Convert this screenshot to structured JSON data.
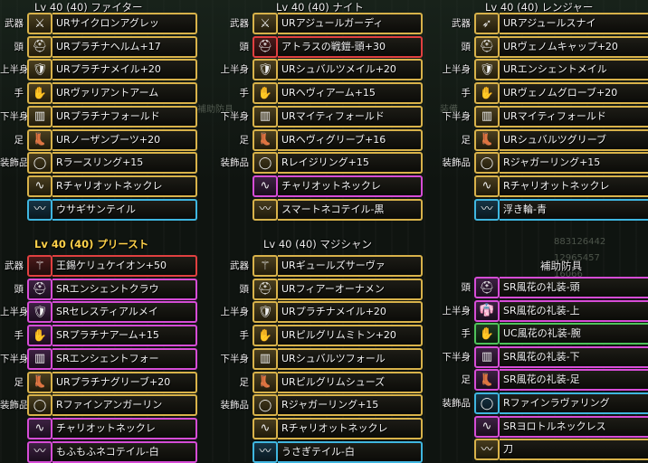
{
  "slot_labels": [
    "武器",
    "頭",
    "上半身",
    "手",
    "下半身",
    "足",
    "装飾品"
  ],
  "panels": [
    {
      "title": "Lv 40 (40) ファイター",
      "items": [
        {
          "slot": "武器",
          "name": "URサイクロンアグレッ",
          "rarity": "ur",
          "icon": "⚔"
        },
        {
          "slot": "頭",
          "name": "URプラチナヘルム+17",
          "rarity": "ur",
          "icon": "⛑"
        },
        {
          "slot": "上半身",
          "name": "URプラチナメイル+20",
          "rarity": "ur",
          "icon": "🛡"
        },
        {
          "slot": "手",
          "name": "URヴァリアントアーム",
          "rarity": "ur",
          "icon": "✋"
        },
        {
          "slot": "下半身",
          "name": "URプラチナフォールド",
          "rarity": "ur",
          "icon": "▥"
        },
        {
          "slot": "足",
          "name": "URノーザンブーツ+20",
          "rarity": "ur",
          "icon": "👢"
        },
        {
          "slot": "装飾品",
          "name": "Rラースリング+15",
          "rarity": "r",
          "icon": "◯"
        },
        {
          "slot": "",
          "name": "Rチャリオットネックレ",
          "rarity": "r",
          "icon": "∿"
        },
        {
          "slot": "",
          "name": "ウサギサンテイル",
          "rarity": "blue",
          "icon": "〰"
        }
      ]
    },
    {
      "title": "Lv 40 (40) ナイト",
      "items": [
        {
          "slot": "武器",
          "name": "URアジュールガーディ",
          "rarity": "ur",
          "icon": "⚔"
        },
        {
          "slot": "頭",
          "name": "アトラスの戦鎧-頭+30",
          "rarity": "red",
          "icon": "⛑"
        },
        {
          "slot": "上半身",
          "name": "URシュバルツメイル+20",
          "rarity": "ur",
          "icon": "🛡"
        },
        {
          "slot": "手",
          "name": "URヘヴィアーム+15",
          "rarity": "ur",
          "icon": "✋"
        },
        {
          "slot": "下半身",
          "name": "URマイティフォールド",
          "rarity": "ur",
          "icon": "▥"
        },
        {
          "slot": "足",
          "name": "URヘヴィグリーブ+16",
          "rarity": "ur",
          "icon": "👢"
        },
        {
          "slot": "装飾品",
          "name": "Rレイジリング+15",
          "rarity": "r",
          "icon": "◯"
        },
        {
          "slot": "",
          "name": "チャリオットネックレ",
          "rarity": "sr",
          "icon": "∿"
        },
        {
          "slot": "",
          "name": "スマートネコテイル-黒",
          "rarity": "r",
          "icon": "〰"
        }
      ]
    },
    {
      "title": "Lv 40 (40) レンジャー",
      "items": [
        {
          "slot": "武器",
          "name": "URアジュールスナイ",
          "rarity": "ur",
          "icon": "➶"
        },
        {
          "slot": "頭",
          "name": "URヴェノムキャップ+20",
          "rarity": "ur",
          "icon": "⛑"
        },
        {
          "slot": "上半身",
          "name": "URエンシェントメイル",
          "rarity": "ur",
          "icon": "🛡"
        },
        {
          "slot": "手",
          "name": "URヴェノムグローブ+20",
          "rarity": "ur",
          "icon": "✋"
        },
        {
          "slot": "下半身",
          "name": "URマイティフォールド",
          "rarity": "ur",
          "icon": "▥"
        },
        {
          "slot": "足",
          "name": "URシュバルツグリーブ",
          "rarity": "ur",
          "icon": "👢"
        },
        {
          "slot": "装飾品",
          "name": "Rジャガーリング+15",
          "rarity": "r",
          "icon": "◯"
        },
        {
          "slot": "",
          "name": "Rチャリオットネックレ",
          "rarity": "r",
          "icon": "∿"
        },
        {
          "slot": "",
          "name": "浮き輪-青",
          "rarity": "blue",
          "icon": "〰"
        }
      ]
    },
    {
      "title": "Lv 40 (40) プリースト",
      "items": [
        {
          "slot": "武器",
          "name": "王錫ケリュケイオン+50",
          "rarity": "red",
          "icon": "⚚"
        },
        {
          "slot": "頭",
          "name": "SRエンシェントクラウ",
          "rarity": "sr",
          "icon": "⛑"
        },
        {
          "slot": "上半身",
          "name": "SRセレスティアルメイ",
          "rarity": "sr",
          "icon": "🛡"
        },
        {
          "slot": "手",
          "name": "SRプラチナアーム+15",
          "rarity": "sr",
          "icon": "✋"
        },
        {
          "slot": "下半身",
          "name": "SRエンシェントフォー",
          "rarity": "sr",
          "icon": "▥"
        },
        {
          "slot": "足",
          "name": "URプラチナグリーブ+20",
          "rarity": "ur",
          "icon": "👢"
        },
        {
          "slot": "装飾品",
          "name": "Rファインアンガーリン",
          "rarity": "r",
          "icon": "◯"
        },
        {
          "slot": "",
          "name": "チャリオットネックレ",
          "rarity": "sr",
          "icon": "∿"
        },
        {
          "slot": "",
          "name": "もふもふネコテイル-白",
          "rarity": "sr",
          "icon": "〰"
        }
      ]
    },
    {
      "title": "Lv 40 (40) マジシャン",
      "items": [
        {
          "slot": "武器",
          "name": "URギュールズサーヴァ",
          "rarity": "ur",
          "icon": "⚚"
        },
        {
          "slot": "頭",
          "name": "URフィアーオーナメン",
          "rarity": "ur",
          "icon": "⛑"
        },
        {
          "slot": "上半身",
          "name": "URプラチナメイル+20",
          "rarity": "ur",
          "icon": "🛡"
        },
        {
          "slot": "手",
          "name": "URピルグリムミトン+20",
          "rarity": "ur",
          "icon": "✋"
        },
        {
          "slot": "下半身",
          "name": "URシュバルツフォール",
          "rarity": "ur",
          "icon": "▥"
        },
        {
          "slot": "足",
          "name": "URピルグリムシューズ",
          "rarity": "ur",
          "icon": "👢"
        },
        {
          "slot": "装飾品",
          "name": "Rジャガーリング+15",
          "rarity": "r",
          "icon": "◯"
        },
        {
          "slot": "",
          "name": "Rチャリオットネックレ",
          "rarity": "r",
          "icon": "∿"
        },
        {
          "slot": "",
          "name": "うさぎテイル-白",
          "rarity": "blue",
          "icon": "〰"
        }
      ]
    },
    {
      "title": "補助防具",
      "items": [
        {
          "slot": "頭",
          "name": "SR風花の礼装-頭",
          "rarity": "sr",
          "icon": "⛑"
        },
        {
          "slot": "上半身",
          "name": "SR風花の礼装-上",
          "rarity": "sr",
          "icon": "👘"
        },
        {
          "slot": "手",
          "name": "UC風花の礼装-腕",
          "rarity": "green",
          "icon": "✋"
        },
        {
          "slot": "下半身",
          "name": "SR風花の礼装-下",
          "rarity": "sr",
          "icon": "▥"
        },
        {
          "slot": "足",
          "name": "SR風花の礼装-足",
          "rarity": "sr",
          "icon": "👢"
        },
        {
          "slot": "装飾品",
          "name": "Rファインラヴァリング",
          "rarity": "blue",
          "icon": "◯"
        },
        {
          "slot": "",
          "name": "SRヨロトルネックレス",
          "rarity": "sr",
          "icon": "∿"
        },
        {
          "slot": "",
          "name": "刀",
          "rarity": "r",
          "icon": "〰"
        }
      ]
    }
  ],
  "background_fragments": [
    "補助防具",
    "装備",
    "883126442",
    "12965457",
    "16066"
  ]
}
